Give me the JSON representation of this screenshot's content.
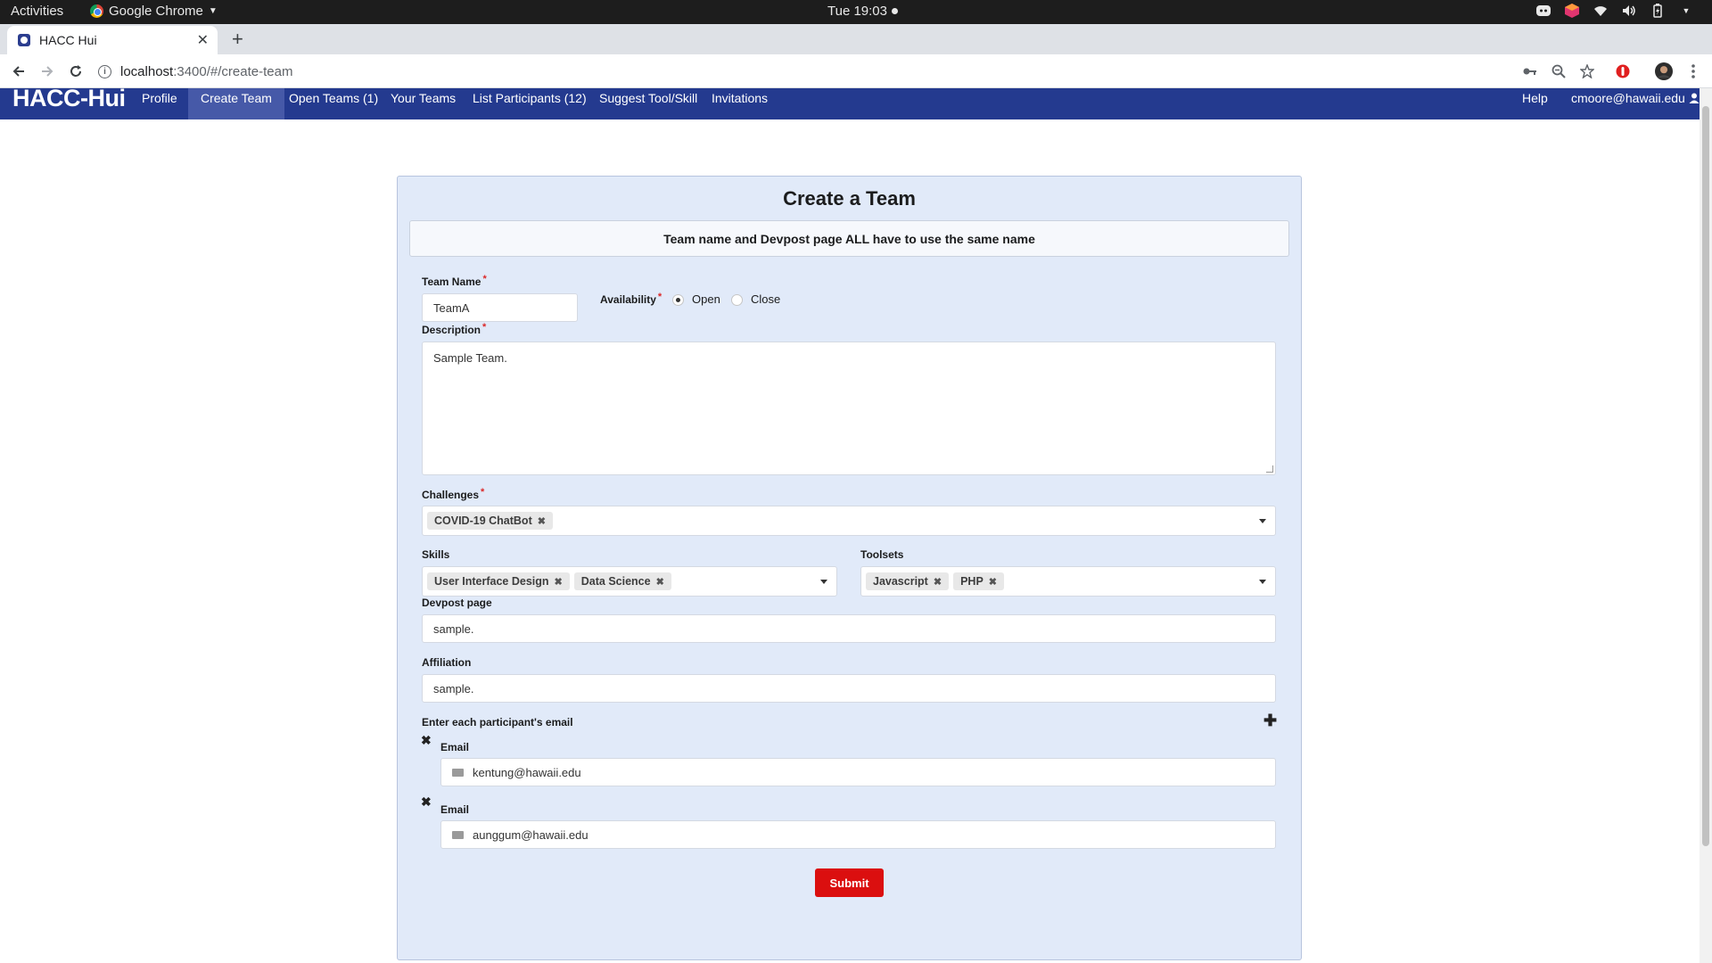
{
  "os_bar": {
    "activities": "Activities",
    "app_name": "Google Chrome",
    "clock": "Tue 19:03"
  },
  "browser": {
    "tab_title": "HACC Hui",
    "url_host": "localhost",
    "url_path": ":3400/#/create-team"
  },
  "navbar": {
    "brand": "HACC-Hui",
    "items": [
      {
        "label": "Profile"
      },
      {
        "label": "Create Team"
      },
      {
        "label": "Open Teams (1)"
      },
      {
        "label": "Your Teams"
      },
      {
        "label": "List Participants (12)"
      },
      {
        "label": "Suggest Tool/Skill"
      },
      {
        "label": "Invitations"
      }
    ],
    "help": "Help",
    "user": "cmoore@hawaii.edu"
  },
  "form": {
    "title": "Create a Team",
    "notice": "Team name and Devpost page ALL have to use the same name",
    "team_name_label": "Team Name",
    "team_name_value": "TeamA",
    "availability_label": "Availability",
    "availability_options": [
      "Open",
      "Close"
    ],
    "availability_selected": "Open",
    "description_label": "Description",
    "description_value": "Sample Team.",
    "challenges_label": "Challenges",
    "challenges": [
      "COVID-19 ChatBot"
    ],
    "skills_label": "Skills",
    "skills": [
      "User Interface Design",
      "Data Science"
    ],
    "toolsets_label": "Toolsets",
    "toolsets": [
      "Javascript",
      "PHP"
    ],
    "devpost_label": "Devpost page",
    "devpost_value": "sample.",
    "affiliation_label": "Affiliation",
    "affiliation_value": "sample.",
    "participants_label": "Enter each participant's email",
    "participants": [
      {
        "label": "Email",
        "value": "kentung@hawaii.edu"
      },
      {
        "label": "Email",
        "value": "aunggum@hawaii.edu"
      }
    ],
    "submit_label": "Submit"
  },
  "colors": {
    "navbar": "#243a8f",
    "navbar_active": "#4659a8",
    "card_bg": "#e1eaf9",
    "submit": "#db0f0f",
    "required": "#db2828"
  }
}
